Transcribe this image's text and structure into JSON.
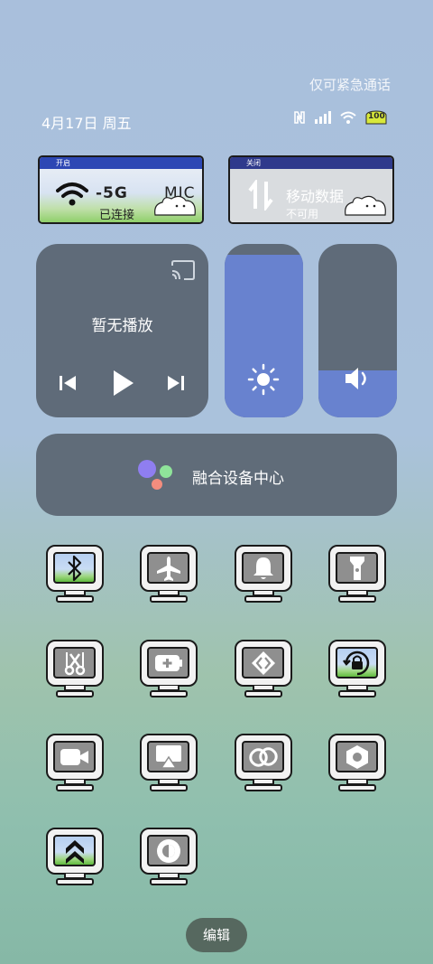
{
  "status": {
    "emergency_text": "仅可紧急通话",
    "date_text": "4月17日 周五",
    "battery_level": "100",
    "accent_color": "#6882cf"
  },
  "tiles": {
    "wifi": {
      "bar": "开启",
      "ssid_left": "-5G",
      "ssid_right": "MIC",
      "status": "已连接"
    },
    "mobile": {
      "bar": "关闭",
      "title": "移动数据",
      "status": "不可用"
    }
  },
  "media": {
    "title": "暂无播放"
  },
  "brightness": {
    "level": 0.94
  },
  "volume": {
    "level": 0.27
  },
  "device_hub": {
    "label": "融合设备中心"
  },
  "toggles": [
    {
      "icon": "bluetooth-icon",
      "on": true
    },
    {
      "icon": "airplane-icon",
      "on": false
    },
    {
      "icon": "bell-icon",
      "on": false
    },
    {
      "icon": "flashlight-icon",
      "on": false
    },
    {
      "icon": "screenshot-icon",
      "on": false
    },
    {
      "icon": "battery-saver-icon",
      "on": false
    },
    {
      "icon": "share-icon",
      "on": false
    },
    {
      "icon": "rotation-lock-icon",
      "on": true
    },
    {
      "icon": "screen-record-icon",
      "on": false
    },
    {
      "icon": "cast-icon",
      "on": false
    },
    {
      "icon": "link-icon",
      "on": false
    },
    {
      "icon": "settings-hex-icon",
      "on": false
    },
    {
      "icon": "performance-icon",
      "on": true
    },
    {
      "icon": "dark-mode-icon",
      "on": false
    }
  ],
  "edit": {
    "label": "编辑"
  }
}
